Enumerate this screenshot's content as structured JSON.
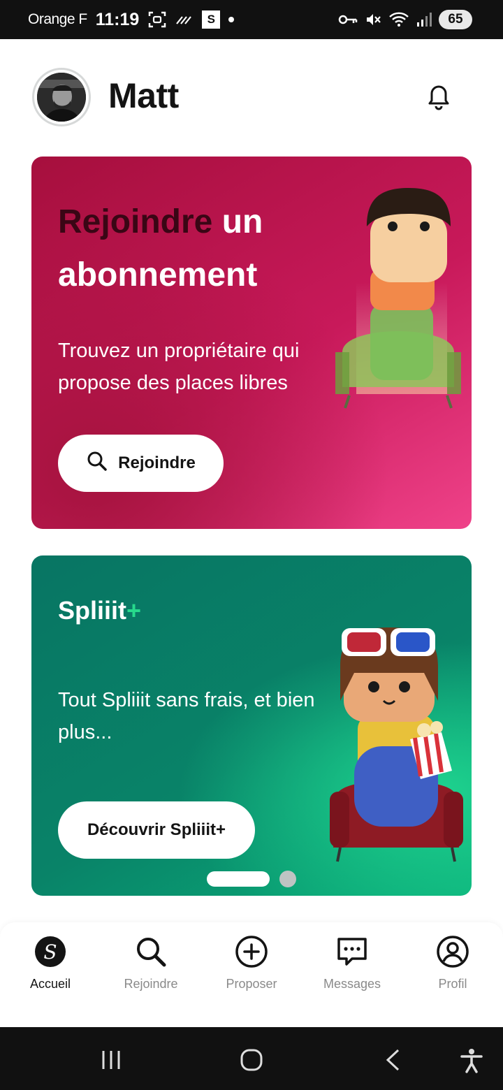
{
  "status_bar": {
    "carrier": "Orange F",
    "time": "11:19",
    "notification_badge": "S",
    "battery": "65"
  },
  "header": {
    "username": "Matt"
  },
  "cards": [
    {
      "title_dark": "Rejoindre",
      "title_light": "un abonnement",
      "description": "Trouvez un propriétaire qui propose des places libres",
      "button_label": "Rejoindre",
      "bg_colors": [
        "#a60f3d",
        "#ef4289"
      ]
    },
    {
      "title": "Spliiit",
      "title_plus": "+",
      "description": "Tout Spliiit sans frais, et bien plus...",
      "button_label": "Découvrir Spliiit+",
      "bg_colors": [
        "#087563",
        "#0ab07a"
      ]
    }
  ],
  "carousel": {
    "pages": 2,
    "active": 0
  },
  "bottom_nav": {
    "items": [
      {
        "label": "Accueil",
        "icon": "spliiit-logo-icon",
        "active": true
      },
      {
        "label": "Rejoindre",
        "icon": "search-icon",
        "active": false
      },
      {
        "label": "Proposer",
        "icon": "plus-circle-icon",
        "active": false
      },
      {
        "label": "Messages",
        "icon": "chat-bubble-icon",
        "active": false
      },
      {
        "label": "Profil",
        "icon": "user-circle-icon",
        "active": false
      }
    ]
  }
}
